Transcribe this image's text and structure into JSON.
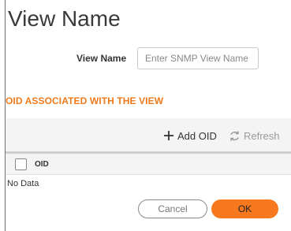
{
  "dialog": {
    "title": "View Name"
  },
  "form": {
    "view_name_label": "View Name",
    "view_name_placeholder": "Enter SNMP View Name",
    "view_name_value": ""
  },
  "oid_section": {
    "heading": "OID ASSOCIATED WITH THE VIEW",
    "toolbar": {
      "add_label": "Add OID",
      "add_icon": "plus-icon",
      "refresh_label": "Refresh",
      "refresh_icon": "refresh-icon"
    },
    "table": {
      "columns": [
        "OID"
      ],
      "empty_text": "No Data"
    }
  },
  "footer": {
    "cancel_label": "Cancel",
    "ok_label": "OK"
  },
  "colors": {
    "accent": "#f07a1a",
    "ok_button": "#f7781e"
  }
}
